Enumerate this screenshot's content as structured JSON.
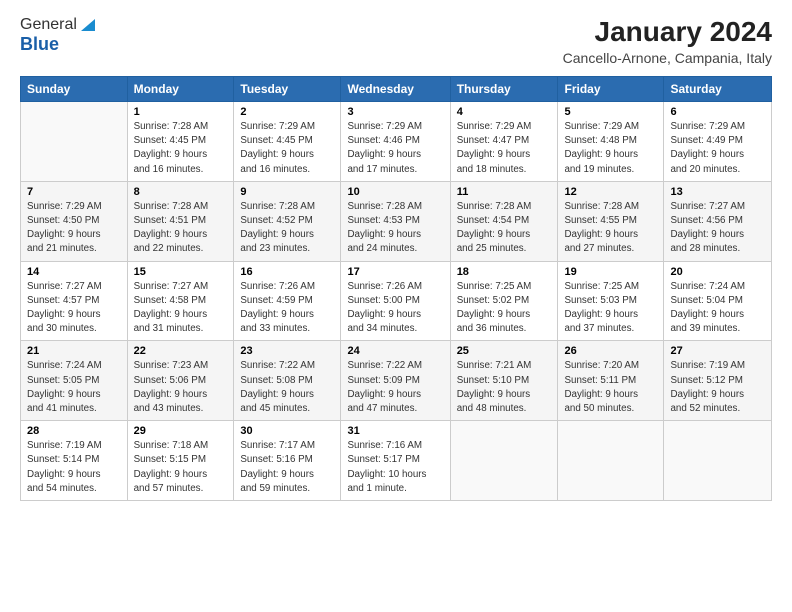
{
  "logo": {
    "line1": "General",
    "line2": "Blue"
  },
  "header": {
    "month": "January 2024",
    "location": "Cancello-Arnone, Campania, Italy"
  },
  "weekdays": [
    "Sunday",
    "Monday",
    "Tuesday",
    "Wednesday",
    "Thursday",
    "Friday",
    "Saturday"
  ],
  "weeks": [
    [
      {
        "day": "",
        "info": ""
      },
      {
        "day": "1",
        "info": "Sunrise: 7:28 AM\nSunset: 4:45 PM\nDaylight: 9 hours\nand 16 minutes."
      },
      {
        "day": "2",
        "info": "Sunrise: 7:29 AM\nSunset: 4:45 PM\nDaylight: 9 hours\nand 16 minutes."
      },
      {
        "day": "3",
        "info": "Sunrise: 7:29 AM\nSunset: 4:46 PM\nDaylight: 9 hours\nand 17 minutes."
      },
      {
        "day": "4",
        "info": "Sunrise: 7:29 AM\nSunset: 4:47 PM\nDaylight: 9 hours\nand 18 minutes."
      },
      {
        "day": "5",
        "info": "Sunrise: 7:29 AM\nSunset: 4:48 PM\nDaylight: 9 hours\nand 19 minutes."
      },
      {
        "day": "6",
        "info": "Sunrise: 7:29 AM\nSunset: 4:49 PM\nDaylight: 9 hours\nand 20 minutes."
      }
    ],
    [
      {
        "day": "7",
        "info": "Sunrise: 7:29 AM\nSunset: 4:50 PM\nDaylight: 9 hours\nand 21 minutes."
      },
      {
        "day": "8",
        "info": "Sunrise: 7:28 AM\nSunset: 4:51 PM\nDaylight: 9 hours\nand 22 minutes."
      },
      {
        "day": "9",
        "info": "Sunrise: 7:28 AM\nSunset: 4:52 PM\nDaylight: 9 hours\nand 23 minutes."
      },
      {
        "day": "10",
        "info": "Sunrise: 7:28 AM\nSunset: 4:53 PM\nDaylight: 9 hours\nand 24 minutes."
      },
      {
        "day": "11",
        "info": "Sunrise: 7:28 AM\nSunset: 4:54 PM\nDaylight: 9 hours\nand 25 minutes."
      },
      {
        "day": "12",
        "info": "Sunrise: 7:28 AM\nSunset: 4:55 PM\nDaylight: 9 hours\nand 27 minutes."
      },
      {
        "day": "13",
        "info": "Sunrise: 7:27 AM\nSunset: 4:56 PM\nDaylight: 9 hours\nand 28 minutes."
      }
    ],
    [
      {
        "day": "14",
        "info": "Sunrise: 7:27 AM\nSunset: 4:57 PM\nDaylight: 9 hours\nand 30 minutes."
      },
      {
        "day": "15",
        "info": "Sunrise: 7:27 AM\nSunset: 4:58 PM\nDaylight: 9 hours\nand 31 minutes."
      },
      {
        "day": "16",
        "info": "Sunrise: 7:26 AM\nSunset: 4:59 PM\nDaylight: 9 hours\nand 33 minutes."
      },
      {
        "day": "17",
        "info": "Sunrise: 7:26 AM\nSunset: 5:00 PM\nDaylight: 9 hours\nand 34 minutes."
      },
      {
        "day": "18",
        "info": "Sunrise: 7:25 AM\nSunset: 5:02 PM\nDaylight: 9 hours\nand 36 minutes."
      },
      {
        "day": "19",
        "info": "Sunrise: 7:25 AM\nSunset: 5:03 PM\nDaylight: 9 hours\nand 37 minutes."
      },
      {
        "day": "20",
        "info": "Sunrise: 7:24 AM\nSunset: 5:04 PM\nDaylight: 9 hours\nand 39 minutes."
      }
    ],
    [
      {
        "day": "21",
        "info": "Sunrise: 7:24 AM\nSunset: 5:05 PM\nDaylight: 9 hours\nand 41 minutes."
      },
      {
        "day": "22",
        "info": "Sunrise: 7:23 AM\nSunset: 5:06 PM\nDaylight: 9 hours\nand 43 minutes."
      },
      {
        "day": "23",
        "info": "Sunrise: 7:22 AM\nSunset: 5:08 PM\nDaylight: 9 hours\nand 45 minutes."
      },
      {
        "day": "24",
        "info": "Sunrise: 7:22 AM\nSunset: 5:09 PM\nDaylight: 9 hours\nand 47 minutes."
      },
      {
        "day": "25",
        "info": "Sunrise: 7:21 AM\nSunset: 5:10 PM\nDaylight: 9 hours\nand 48 minutes."
      },
      {
        "day": "26",
        "info": "Sunrise: 7:20 AM\nSunset: 5:11 PM\nDaylight: 9 hours\nand 50 minutes."
      },
      {
        "day": "27",
        "info": "Sunrise: 7:19 AM\nSunset: 5:12 PM\nDaylight: 9 hours\nand 52 minutes."
      }
    ],
    [
      {
        "day": "28",
        "info": "Sunrise: 7:19 AM\nSunset: 5:14 PM\nDaylight: 9 hours\nand 54 minutes."
      },
      {
        "day": "29",
        "info": "Sunrise: 7:18 AM\nSunset: 5:15 PM\nDaylight: 9 hours\nand 57 minutes."
      },
      {
        "day": "30",
        "info": "Sunrise: 7:17 AM\nSunset: 5:16 PM\nDaylight: 9 hours\nand 59 minutes."
      },
      {
        "day": "31",
        "info": "Sunrise: 7:16 AM\nSunset: 5:17 PM\nDaylight: 10 hours\nand 1 minute."
      },
      {
        "day": "",
        "info": ""
      },
      {
        "day": "",
        "info": ""
      },
      {
        "day": "",
        "info": ""
      }
    ]
  ]
}
